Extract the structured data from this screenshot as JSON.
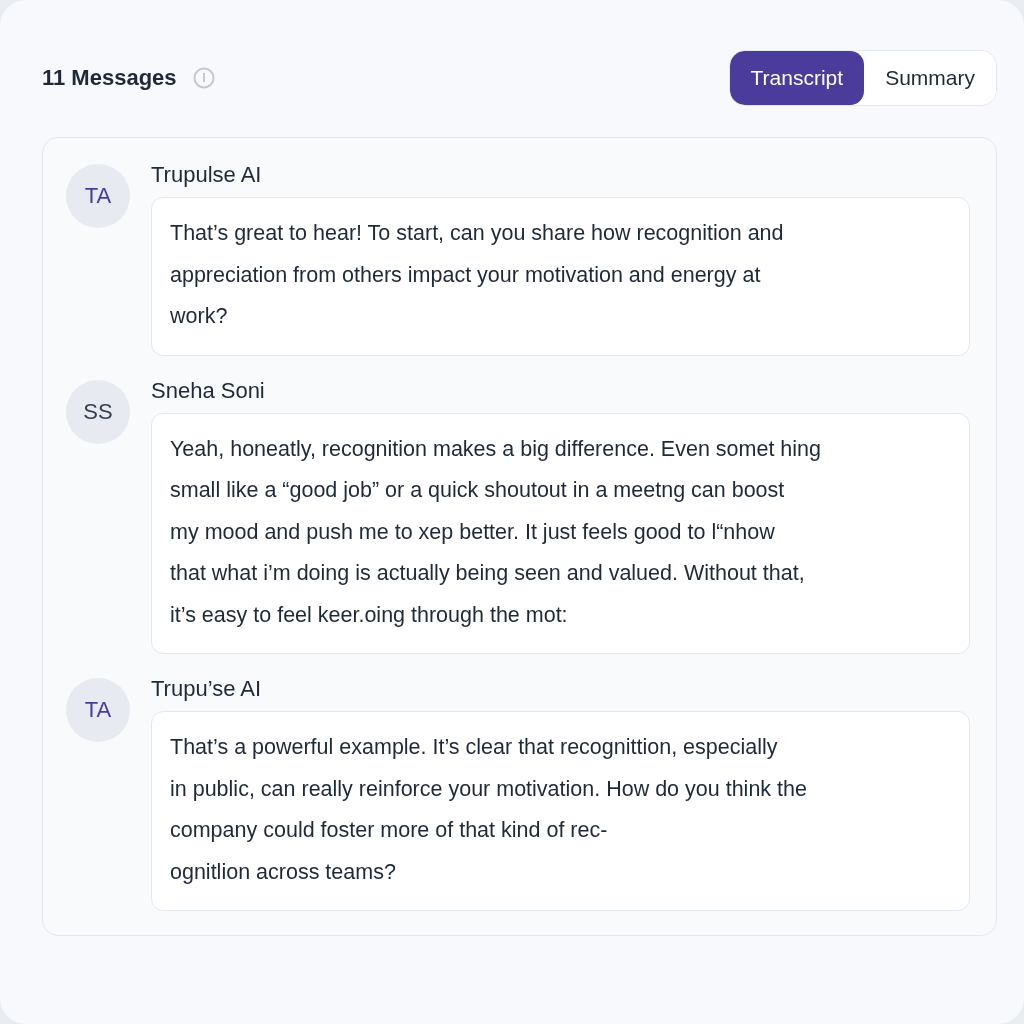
{
  "header": {
    "count_label": "11 Messages"
  },
  "tabs": [
    {
      "label": "Transcript",
      "selected": true
    },
    {
      "label": "Summary",
      "selected": false
    }
  ],
  "messages": [
    {
      "initials": "TA",
      "kind": "ai",
      "sender": "Trupulse AI",
      "lines": [
        "That’s great to hear! To start, can you share how  recognition and",
        "appreciation from others impact your motivation and energy at",
        "work?"
      ]
    },
    {
      "initials": "SS",
      "kind": "user",
      "sender": "Sneha Soni",
      "lines": [
        "Yeah, honeatly, recognition makes a big difference. Even somet hing",
        "small like a  “good job” or a quick shoutout in a meetng can boost",
        "my mood and push me to xep better. It just feels good to l“nhow",
        "that what i’m doing is actually being seen and valued. Without that,",
        "it’s easy to feel keer.oing through the mot:"
      ]
    },
    {
      "initials": "TA",
      "kind": "ai",
      "sender": "Trupu’se AI",
      "lines": [
        "That’s a powerful example. It’s clear that recognittion, especially",
        "in public, can really reinforce your motivation. How do you think the",
        "company could foster more of that kind of rec-",
        "ognitlion across teams?"
      ]
    }
  ]
}
